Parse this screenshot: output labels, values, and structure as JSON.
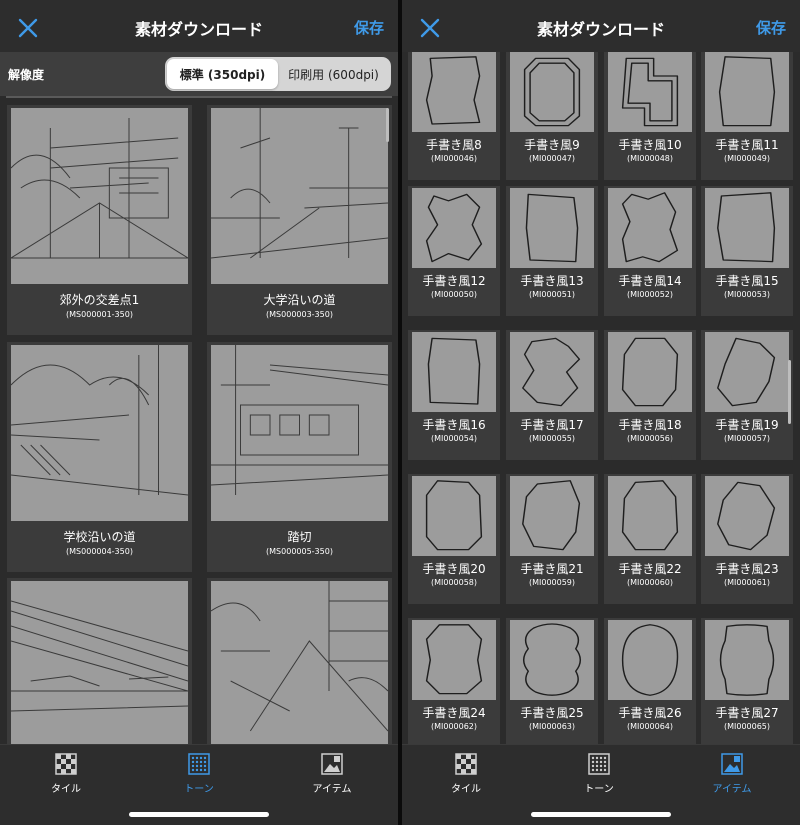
{
  "left_screen": {
    "title": "素材ダウンロード",
    "save_label": "保存",
    "resolution": {
      "label": "解像度",
      "options": [
        "標準 (350dpi)",
        "印刷用 (600dpi)"
      ],
      "selected": "標準 (350dpi)"
    },
    "materials": [
      {
        "name": "郊外の交差点1",
        "code": "(MS000001-350)"
      },
      {
        "name": "大学沿いの道",
        "code": "(MS000003-350)"
      },
      {
        "name": "学校沿いの道",
        "code": "(MS000004-350)"
      },
      {
        "name": "踏切",
        "code": "(MS000005-350)"
      },
      {
        "name": "",
        "code": ""
      },
      {
        "name": "",
        "code": ""
      }
    ],
    "tabs": [
      {
        "label": "タイル",
        "icon": "tile-icon"
      },
      {
        "label": "トーン",
        "icon": "tone-icon"
      },
      {
        "label": "アイテム",
        "icon": "item-icon"
      }
    ],
    "active_tab": "トーン"
  },
  "right_screen": {
    "title": "素材ダウンロード",
    "save_label": "保存",
    "items": [
      {
        "name": "手書き風8",
        "code": "(MI000046)"
      },
      {
        "name": "手書き風9",
        "code": "(MI000047)"
      },
      {
        "name": "手書き風10",
        "code": "(MI000048)"
      },
      {
        "name": "手書き風11",
        "code": "(MI000049)"
      },
      {
        "name": "手書き風12",
        "code": "(MI000050)"
      },
      {
        "name": "手書き風13",
        "code": "(MI000051)"
      },
      {
        "name": "手書き風14",
        "code": "(MI000052)"
      },
      {
        "name": "手書き風15",
        "code": "(MI000053)"
      },
      {
        "name": "手書き風16",
        "code": "(MI000054)"
      },
      {
        "name": "手書き風17",
        "code": "(MI000055)"
      },
      {
        "name": "手書き風18",
        "code": "(MI000056)"
      },
      {
        "name": "手書き風19",
        "code": "(MI000057)"
      },
      {
        "name": "手書き風20",
        "code": "(MI000058)"
      },
      {
        "name": "手書き風21",
        "code": "(MI000059)"
      },
      {
        "name": "手書き風22",
        "code": "(MI000060)"
      },
      {
        "name": "手書き風23",
        "code": "(MI000061)"
      },
      {
        "name": "手書き風24",
        "code": "(MI000062)"
      },
      {
        "name": "手書き風25",
        "code": "(MI000063)"
      },
      {
        "name": "手書き風26",
        "code": "(MI000064)"
      },
      {
        "name": "手書き風27",
        "code": "(MI000065)"
      }
    ],
    "tabs": [
      {
        "label": "タイル",
        "icon": "tile-icon"
      },
      {
        "label": "トーン",
        "icon": "tone-icon"
      },
      {
        "label": "アイテム",
        "icon": "item-icon"
      }
    ],
    "active_tab": "アイテム"
  },
  "colors": {
    "accent": "#3f9ae8",
    "panel_bg": "#2b2b2b",
    "card_bg": "#3b3b3b",
    "thumb_bg": "#9c9c9c"
  }
}
